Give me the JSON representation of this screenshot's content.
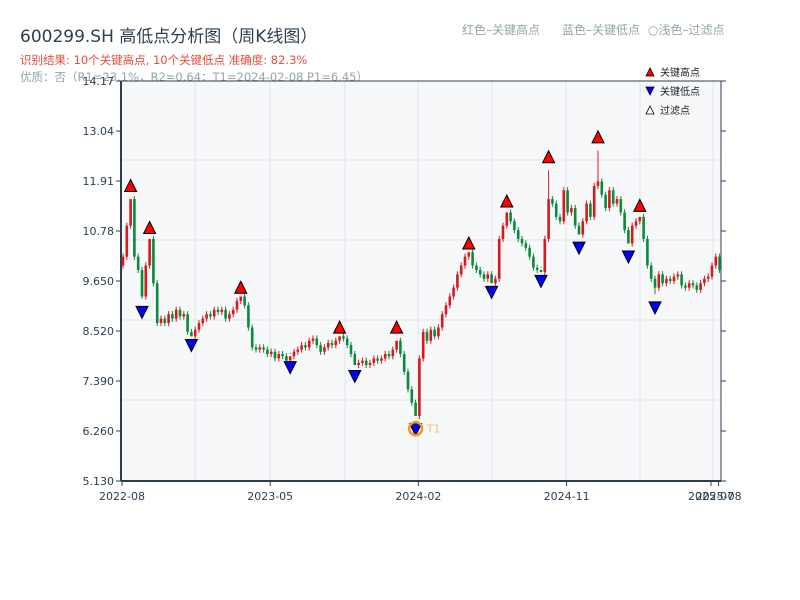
{
  "header": {
    "title": "600299.SH 高低点分析图（周K线图）",
    "result": "识别结果: 10个关键高点, 10个关键低点   准确度: 82.3%",
    "quality": "优质：否（R1=23.1%，R2=0.64；T1=2024-02-08 P1=6.45）",
    "hint_red": "红色–关键高点",
    "hint_blue": "蓝色–关键低点",
    "hint_light": "○浅色–过滤点"
  },
  "chart_data": {
    "type": "candlestick",
    "title": "600299.SH 高低点分析图（周K线图）",
    "ylim": [
      5.13,
      14.17
    ],
    "y_ticks": [
      "14.17",
      "13.04",
      "11.91",
      "10.78",
      "9.650",
      "8.520",
      "7.390",
      "6.260",
      "5.130"
    ],
    "x_ticks": [
      {
        "label": "2022-08",
        "index": 0
      },
      {
        "label": "2023-05",
        "index": 39
      },
      {
        "label": "2024-02",
        "index": 78
      },
      {
        "label": "2024-11",
        "index": 117
      },
      {
        "label": "2025-07",
        "index": 155
      },
      {
        "label": "2025-08",
        "index": 157
      }
    ],
    "up_color": "#d7191c",
    "down_color": "#0a8a3a",
    "closes": [
      10.2,
      10.9,
      11.5,
      10.2,
      9.9,
      9.3,
      10.0,
      10.6,
      9.6,
      8.7,
      8.8,
      8.7,
      8.9,
      8.8,
      9.0,
      8.85,
      8.9,
      8.5,
      8.4,
      8.55,
      8.7,
      8.8,
      8.9,
      8.85,
      9.0,
      8.95,
      9.0,
      8.8,
      8.9,
      9.0,
      9.2,
      9.3,
      9.1,
      8.6,
      8.15,
      8.1,
      8.15,
      8.1,
      8.0,
      8.05,
      7.9,
      8.0,
      7.95,
      7.85,
      7.95,
      8.05,
      8.1,
      8.2,
      8.15,
      8.3,
      8.35,
      8.2,
      8.05,
      8.15,
      8.25,
      8.2,
      8.3,
      8.4,
      8.35,
      8.2,
      8.0,
      7.75,
      7.8,
      7.85,
      7.75,
      7.8,
      7.9,
      7.85,
      7.9,
      8.0,
      7.95,
      8.1,
      8.3,
      8.0,
      7.6,
      7.2,
      6.9,
      6.6,
      7.9,
      8.5,
      8.3,
      8.55,
      8.4,
      8.6,
      8.9,
      9.1,
      9.3,
      9.5,
      9.8,
      10.0,
      10.2,
      10.3,
      10.0,
      9.9,
      9.8,
      9.7,
      9.8,
      9.6,
      9.7,
      10.6,
      10.9,
      11.2,
      11.0,
      10.8,
      10.6,
      10.5,
      10.4,
      10.2,
      9.95,
      9.9,
      9.85,
      10.6,
      11.5,
      11.4,
      11.1,
      11.0,
      11.7,
      11.2,
      11.3,
      10.9,
      10.7,
      11.0,
      11.4,
      11.1,
      11.8,
      11.9,
      11.6,
      11.3,
      11.7,
      11.4,
      11.5,
      11.2,
      10.8,
      10.5,
      10.9,
      11.0,
      11.1,
      10.6,
      10.0,
      9.7,
      9.5,
      9.8,
      9.6,
      9.7,
      9.65,
      9.75,
      9.8,
      9.55,
      9.5,
      9.6,
      9.55,
      9.45,
      9.6,
      9.7,
      9.75,
      10.0,
      10.2,
      9.9
    ],
    "key_highs": [
      {
        "index": 2,
        "price": 11.65
      },
      {
        "index": 7,
        "price": 10.7
      },
      {
        "index": 31,
        "price": 9.35
      },
      {
        "index": 57,
        "price": 8.45
      },
      {
        "index": 72,
        "price": 8.45
      },
      {
        "index": 91,
        "price": 10.35
      },
      {
        "index": 101,
        "price": 11.3
      },
      {
        "index": 112,
        "price": 12.3
      },
      {
        "index": 125,
        "price": 12.75
      },
      {
        "index": 136,
        "price": 11.2
      }
    ],
    "key_lows": [
      {
        "index": 5,
        "price": 9.1
      },
      {
        "index": 18,
        "price": 8.35
      },
      {
        "index": 44,
        "price": 7.85
      },
      {
        "index": 61,
        "price": 7.65
      },
      {
        "index": 77,
        "price": 6.45
      },
      {
        "index": 97,
        "price": 9.55
      },
      {
        "index": 110,
        "price": 9.8
      },
      {
        "index": 120,
        "price": 10.55
      },
      {
        "index": 133,
        "price": 10.35
      },
      {
        "index": 140,
        "price": 9.2
      }
    ],
    "annotation": {
      "label": "T1",
      "index": 77,
      "price": 6.45,
      "color": "#f39c12"
    },
    "legend": {
      "placement": "top-right",
      "items": [
        {
          "label": "关键高点",
          "color": "#ff0000",
          "shape": "triangle-up"
        },
        {
          "label": "关键低点",
          "color": "#0000ff",
          "shape": "triangle-down"
        },
        {
          "label": "过滤点",
          "color": "#ffffff",
          "shape": "triangle-up"
        }
      ]
    }
  }
}
